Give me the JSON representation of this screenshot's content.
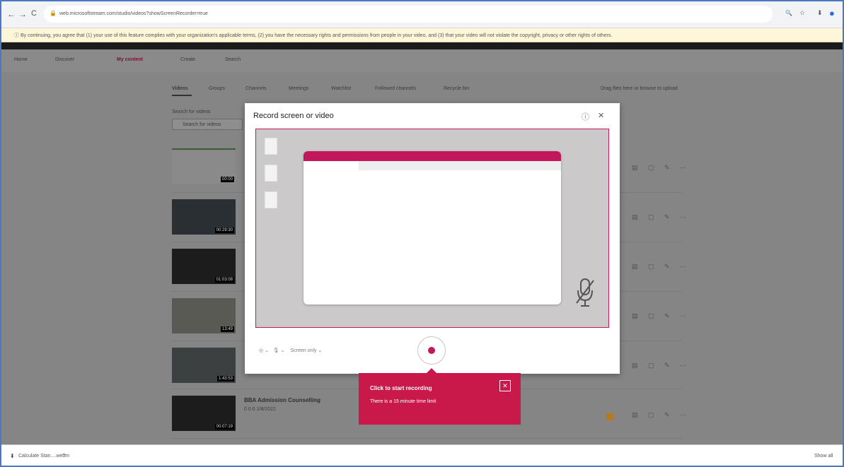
{
  "browser": {
    "url": "web.microsoftstream.com/studio/videos?showScreenRecorder=true",
    "nav_back": "←",
    "nav_forward": "→",
    "nav_reload": "C",
    "lock": "🔒",
    "toolbar_icons": [
      "🔍",
      "☆",
      "⬇",
      "●"
    ]
  },
  "infobar": {
    "icon": "ⓘ",
    "text": "By continuing, you agree that (1) your use of this feature complies with your organization's applicable terms, (2) you have the necessary rights and permissions from people in your video, and (3) that your video will not violate the copyright, privacy or other rights of others."
  },
  "nav": {
    "home": "Home",
    "discover": "Discover",
    "my_content": "My content",
    "create": "Create",
    "search": "Search"
  },
  "tabs": [
    "Videos",
    "Groups",
    "Channels",
    "Meetings",
    "Watchlist",
    "Followed channels",
    "Recycle bin"
  ],
  "upload_hint": "Drag files here or browse to upload",
  "search": {
    "label": "Search for videos",
    "placeholder": "Search for videos"
  },
  "videos": [
    {
      "duration": "00:00"
    },
    {
      "duration": "00:29:30"
    },
    {
      "duration": "01:03:08"
    },
    {
      "duration": "13:49"
    },
    {
      "duration": "1:43:53"
    },
    {
      "duration": "00:07:19",
      "title": "BBA Admission Counselling",
      "meta": "0    0    0    1/8/2022"
    }
  ],
  "dialog": {
    "title": "Record screen or video",
    "help_icon": "ⓘ",
    "close_icon": "✕",
    "toolbar_source": "Screen only",
    "camera_icon": "◎",
    "mic_icon": "🎙",
    "muted_mic": "🎙"
  },
  "tooltip": {
    "title": "Click to start recording",
    "subtitle": "There is a 15 minute time limit",
    "close": "✕"
  },
  "download": {
    "file": "Calculate Stan....webm",
    "chevron": "⌃",
    "show_all": "Show all"
  },
  "colors": {
    "accent": "#c2185b",
    "tooltip": "#c9184a",
    "overlay": "#858585"
  }
}
